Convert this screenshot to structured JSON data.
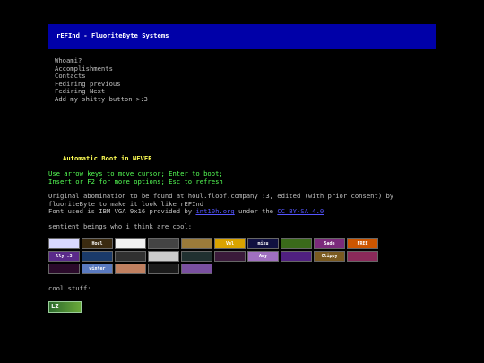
{
  "header": {
    "title": "rEFInd - FluoriteByte Systems"
  },
  "menu": {
    "items": [
      {
        "label": "Whoami?"
      },
      {
        "label": "Accomplishments"
      },
      {
        "label": "Contacts"
      },
      {
        "label": "Fediring previous"
      },
      {
        "label": "Fediring Next"
      },
      {
        "label": "Add my shitty button >:3"
      }
    ]
  },
  "boot": {
    "text": "Automatic Boot in NEVER"
  },
  "help": {
    "line1": "Use arrow keys to move cursor; Enter to boot;",
    "line2": "Insert or F2 for more options; Esc to refresh"
  },
  "info": {
    "line1": "Original abomination to be found at houl.floof.company :3, edited (with prior consent) by",
    "line2": "fluoriteByte to make it look like rEFInd",
    "font_prefix": "Font used is IBM VGA 9x16 provided by ",
    "font_link": "int10h.org",
    "font_middle": " under the ",
    "license_link": "CC BY-SA 4.0"
  },
  "sentient": {
    "label": "sentient beings who i think are cool:"
  },
  "buttons": {
    "row1": [
      {
        "text": "",
        "color": "#d9d9ff"
      },
      {
        "text": "Houl",
        "color": "#3a2a10"
      },
      {
        "text": "",
        "color": "#f2f2f2"
      },
      {
        "text": "",
        "color": "#444444"
      },
      {
        "text": "",
        "color": "#9b7b3a"
      },
      {
        "text": "Vel",
        "color": "#d9a300"
      },
      {
        "text": "miku",
        "color": "#101040"
      },
      {
        "text": "",
        "color": "#3a6a1a"
      },
      {
        "text": "Sade",
        "color": "#7b2a7b"
      },
      {
        "text": "FREE",
        "color": "#cc5500"
      }
    ],
    "row2": [
      {
        "text": "lly :3",
        "color": "#5a2a8a"
      },
      {
        "text": "",
        "color": "#1a3a6a"
      },
      {
        "text": "",
        "color": "#303030"
      },
      {
        "text": "",
        "color": "#cccccc"
      },
      {
        "text": "",
        "color": "#203030"
      },
      {
        "text": "",
        "color": "#3a1a3a"
      },
      {
        "text": "Amy",
        "color": "#a070c0"
      },
      {
        "text": "",
        "color": "#502080"
      },
      {
        "text": "Clippy",
        "color": "#7a5a20"
      },
      {
        "text": "",
        "color": "#8a2a5a"
      }
    ],
    "row3": [
      {
        "text": "",
        "color": "#2a0a2a"
      },
      {
        "text": "winter",
        "color": "#5a7ac0"
      },
      {
        "text": "",
        "color": "#c08060"
      },
      {
        "text": "",
        "color": "#1a1a1a"
      },
      {
        "text": "",
        "color": "#7a50a0"
      }
    ]
  },
  "cool": {
    "label": "cool stuff:",
    "button": "LZ"
  }
}
